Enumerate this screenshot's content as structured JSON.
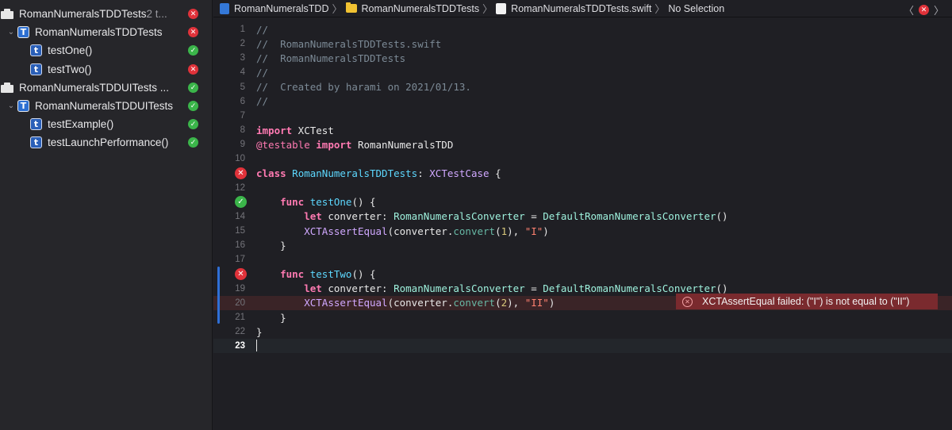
{
  "navigator": {
    "items": [
      {
        "label": "RomanNumeralsTDDTests",
        "suffix": " 2 t...",
        "kind": "bundle",
        "status": "fail",
        "indent": 0,
        "chevron": ""
      },
      {
        "label": "RomanNumeralsTDDTests",
        "kind": "target",
        "status": "fail",
        "indent": 1,
        "chevron": "⌄"
      },
      {
        "label": "testOne()",
        "kind": "test",
        "status": "pass",
        "indent": 2,
        "chevron": ""
      },
      {
        "label": "testTwo()",
        "kind": "test",
        "status": "fail",
        "indent": 2,
        "chevron": ""
      },
      {
        "label": "RomanNumeralsTDDUITests ...",
        "kind": "bundle",
        "status": "pass",
        "indent": 0,
        "chevron": ""
      },
      {
        "label": "RomanNumeralsTDDUITests",
        "kind": "target",
        "status": "pass",
        "indent": 1,
        "chevron": "⌄"
      },
      {
        "label": "testExample()",
        "kind": "test",
        "status": "pass",
        "indent": 2,
        "chevron": ""
      },
      {
        "label": "testLaunchPerformance()",
        "kind": "test",
        "status": "pass",
        "indent": 2,
        "chevron": ""
      }
    ],
    "icon_text": {
      "target": "T",
      "test": "t",
      "pass": "✓",
      "fail": "✕"
    }
  },
  "jumpbar": {
    "crumbs": [
      {
        "label": "RomanNumeralsTDD",
        "icon": "project-icon"
      },
      {
        "label": "RomanNumeralsTDDTests",
        "icon": "folder-icon"
      },
      {
        "label": "RomanNumeralsTDDTests.swift",
        "icon": "swift-file-icon"
      },
      {
        "label": "No Selection",
        "icon": ""
      }
    ],
    "separator": "〉",
    "back_glyph": "〈",
    "forward_glyph": "〉",
    "error_glyph": "✕"
  },
  "editor": {
    "lines": [
      {
        "n": "1",
        "tokens": [
          [
            "c-comment",
            "//"
          ]
        ]
      },
      {
        "n": "2",
        "tokens": [
          [
            "c-comment",
            "//  RomanNumeralsTDDTests.swift"
          ]
        ]
      },
      {
        "n": "3",
        "tokens": [
          [
            "c-comment",
            "//  RomanNumeralsTDDTests"
          ]
        ]
      },
      {
        "n": "4",
        "tokens": [
          [
            "c-comment",
            "//"
          ]
        ]
      },
      {
        "n": "5",
        "tokens": [
          [
            "c-comment",
            "//  Created by harami on 2021/01/13."
          ]
        ]
      },
      {
        "n": "6",
        "tokens": [
          [
            "c-comment",
            "//"
          ]
        ]
      },
      {
        "n": "7",
        "tokens": []
      },
      {
        "n": "8",
        "tokens": [
          [
            "c-kw",
            "import"
          ],
          [
            "",
            " XCTest"
          ]
        ]
      },
      {
        "n": "9",
        "tokens": [
          [
            "c-attr",
            "@testable"
          ],
          [
            "",
            " "
          ],
          [
            "c-kw",
            "import"
          ],
          [
            "",
            " RomanNumeralsTDD"
          ]
        ]
      },
      {
        "n": "10",
        "tokens": []
      },
      {
        "n": "11",
        "mark": "fail",
        "tokens": [
          [
            "c-kw",
            "class"
          ],
          [
            "",
            " "
          ],
          [
            "c-type",
            "RomanNumeralsTDDTests"
          ],
          [
            "",
            ": "
          ],
          [
            "c-type3",
            "XCTestCase"
          ],
          [
            "",
            " {"
          ]
        ]
      },
      {
        "n": "12",
        "tokens": []
      },
      {
        "n": "13",
        "mark": "pass",
        "tokens": [
          [
            "",
            "    "
          ],
          [
            "c-kw",
            "func"
          ],
          [
            "",
            " "
          ],
          [
            "c-type",
            "testOne"
          ],
          [
            "",
            "() {"
          ]
        ]
      },
      {
        "n": "14",
        "tokens": [
          [
            "",
            "        "
          ],
          [
            "c-kw",
            "let"
          ],
          [
            "",
            " converter: "
          ],
          [
            "c-type2",
            "RomanNumeralsConverter"
          ],
          [
            "",
            " = "
          ],
          [
            "c-type2",
            "DefaultRomanNumeralsConverter"
          ],
          [
            "",
            "()"
          ]
        ]
      },
      {
        "n": "15",
        "tokens": [
          [
            "",
            "        "
          ],
          [
            "c-func2",
            "XCTAssertEqual"
          ],
          [
            "",
            "(converter."
          ],
          [
            "c-func",
            "convert"
          ],
          [
            "",
            "("
          ],
          [
            "c-num",
            "1"
          ],
          [
            "",
            "), "
          ],
          [
            "c-str",
            "\"I\""
          ],
          [
            "",
            ")"
          ]
        ]
      },
      {
        "n": "16",
        "tokens": [
          [
            "",
            "    }"
          ]
        ]
      },
      {
        "n": "17",
        "tokens": []
      },
      {
        "n": "18",
        "mark": "fail",
        "tokens": [
          [
            "",
            "    "
          ],
          [
            "c-kw",
            "func"
          ],
          [
            "",
            " "
          ],
          [
            "c-type",
            "testTwo"
          ],
          [
            "",
            "() {"
          ]
        ]
      },
      {
        "n": "19",
        "tokens": [
          [
            "",
            "        "
          ],
          [
            "c-kw",
            "let"
          ],
          [
            "",
            " converter: "
          ],
          [
            "c-type2",
            "RomanNumeralsConverter"
          ],
          [
            "",
            " = "
          ],
          [
            "c-type2",
            "DefaultRomanNumeralsConverter"
          ],
          [
            "",
            "()"
          ]
        ]
      },
      {
        "n": "20",
        "error": true,
        "tokens": [
          [
            "",
            "        "
          ],
          [
            "c-func2",
            "XCTAssertEqual"
          ],
          [
            "",
            "(converter."
          ],
          [
            "c-func",
            "convert"
          ],
          [
            "",
            "("
          ],
          [
            "c-num",
            "2"
          ],
          [
            "",
            "), "
          ],
          [
            "c-str",
            "\"II\""
          ],
          [
            "",
            ")"
          ]
        ]
      },
      {
        "n": "21",
        "tokens": [
          [
            "",
            "    }"
          ]
        ]
      },
      {
        "n": "22",
        "tokens": [
          [
            "",
            "}"
          ]
        ]
      },
      {
        "n": "23",
        "current": true,
        "tokens": []
      }
    ],
    "error_message": "XCTAssertEqual failed: (\"I\") is not equal to (\"II\")",
    "error_glyph": "✕",
    "mark_glyphs": {
      "pass": "✓",
      "fail": "✕"
    }
  }
}
